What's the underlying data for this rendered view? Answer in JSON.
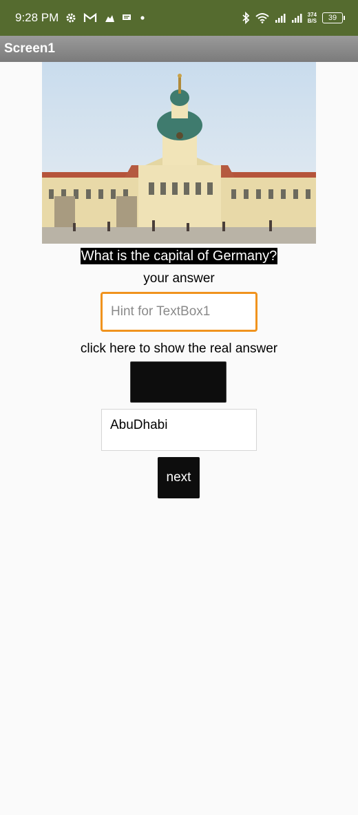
{
  "status_bar": {
    "time": "9:28 PM",
    "net_speed_value": "374",
    "net_speed_unit": "B/S",
    "battery": "39",
    "icons": [
      "gear-icon",
      "gmail-icon",
      "puzzle-icon",
      "message-icon",
      "dot-icon",
      "bluetooth-icon",
      "wifi-icon",
      "signal-icon",
      "signal-icon-2"
    ]
  },
  "app_bar": {
    "title": "Screen1"
  },
  "main": {
    "image_subject": "palace-photo",
    "question": "What is the capital of Germany?",
    "your_answer_label": "your answer",
    "answer_input": {
      "placeholder": "Hint for TextBox1",
      "value": ""
    },
    "reveal_hint": "click here to show the real answer",
    "revealed_answer": "AbuDhabi",
    "next_label": "next"
  },
  "colors": {
    "status_bar": "#556b2f",
    "app_bar": "#888888",
    "input_border": "#f0931e",
    "button": "#0d0d0d"
  }
}
